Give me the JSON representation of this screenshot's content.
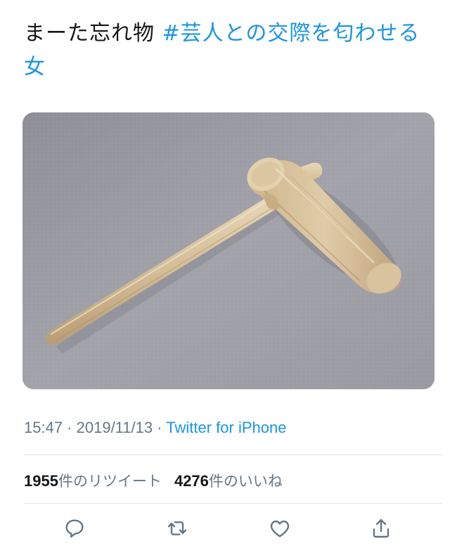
{
  "tweet": {
    "text_plain": "まーた忘れ物 ",
    "hashtag_line1": "#芸人との交際を匂わせ",
    "hashtag_line2": "る女"
  },
  "media": {
    "alt_icon": "wooden-crepe-spreader-photo"
  },
  "meta": {
    "time": "15:47",
    "sep1": " · ",
    "date": "2019/11/13",
    "sep2": " · ",
    "source": "Twitter for iPhone"
  },
  "stats": {
    "retweet_count": "1955",
    "retweet_label": "件のリツイート",
    "like_count": "4276",
    "like_label": "件のいいね"
  },
  "actions": {
    "reply_icon": "reply-icon",
    "retweet_icon": "retweet-icon",
    "like_icon": "heart-icon",
    "share_icon": "share-icon"
  },
  "colors": {
    "link": "#1b95e0",
    "secondary_text": "#657786",
    "primary_text": "#14171a",
    "divider": "#e1e8ed"
  }
}
